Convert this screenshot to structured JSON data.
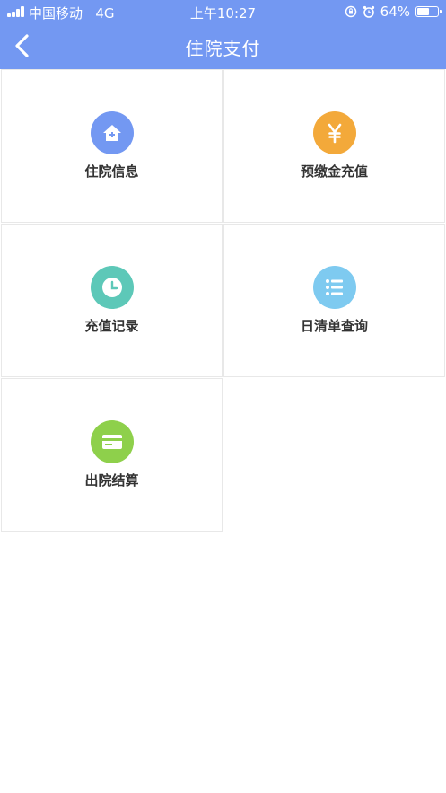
{
  "status_bar": {
    "carrier": "中国移动",
    "network": "4G",
    "time": "上午10:27",
    "battery": "64%",
    "battery_level": 0.64
  },
  "nav": {
    "title": "住院支付",
    "back_icon": "chevron-left-icon"
  },
  "colors": {
    "header": "#7398f2",
    "inpatient_info": "#7398f2",
    "prepay": "#f3a93a",
    "recharge_record": "#5dc8b8",
    "daily_list": "#7ecaf0",
    "discharge": "#8ed04b"
  },
  "menu": {
    "items": [
      {
        "label": "住院信息",
        "icon": "house-icon"
      },
      {
        "label": "预缴金充值",
        "icon": "yen-icon"
      },
      {
        "label": "充值记录",
        "icon": "clock-icon"
      },
      {
        "label": "日清单查询",
        "icon": "list-icon"
      },
      {
        "label": "出院结算",
        "icon": "card-icon"
      }
    ]
  }
}
